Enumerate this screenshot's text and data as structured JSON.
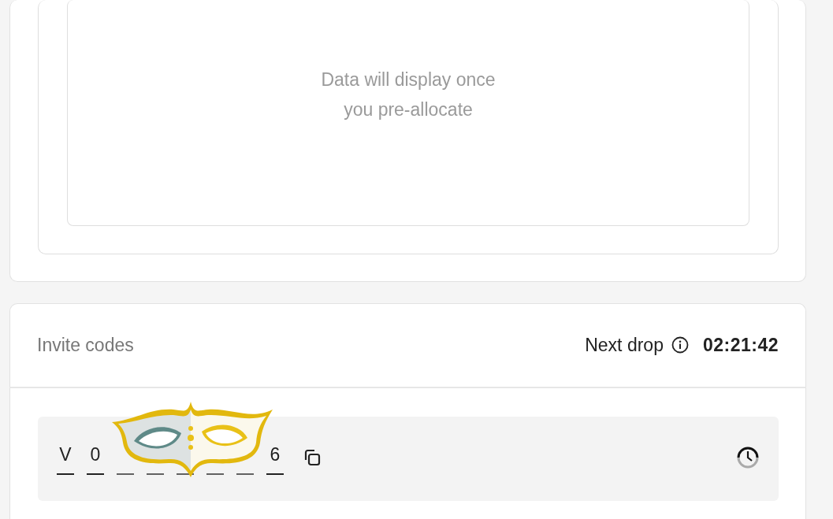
{
  "allocation_panel": {
    "empty_message": "Data will display once\nyou pre-allocate"
  },
  "invite_codes": {
    "title": "Invite codes",
    "next_drop_label": "Next drop",
    "countdown": "02:21:42",
    "code_slots": [
      {
        "char": "V",
        "hidden": false
      },
      {
        "char": "0",
        "hidden": false
      },
      {
        "hidden": true
      },
      {
        "hidden": true
      },
      {
        "hidden": true
      },
      {
        "hidden": true
      },
      {
        "hidden": true
      },
      {
        "char": "6",
        "hidden": false
      }
    ]
  }
}
